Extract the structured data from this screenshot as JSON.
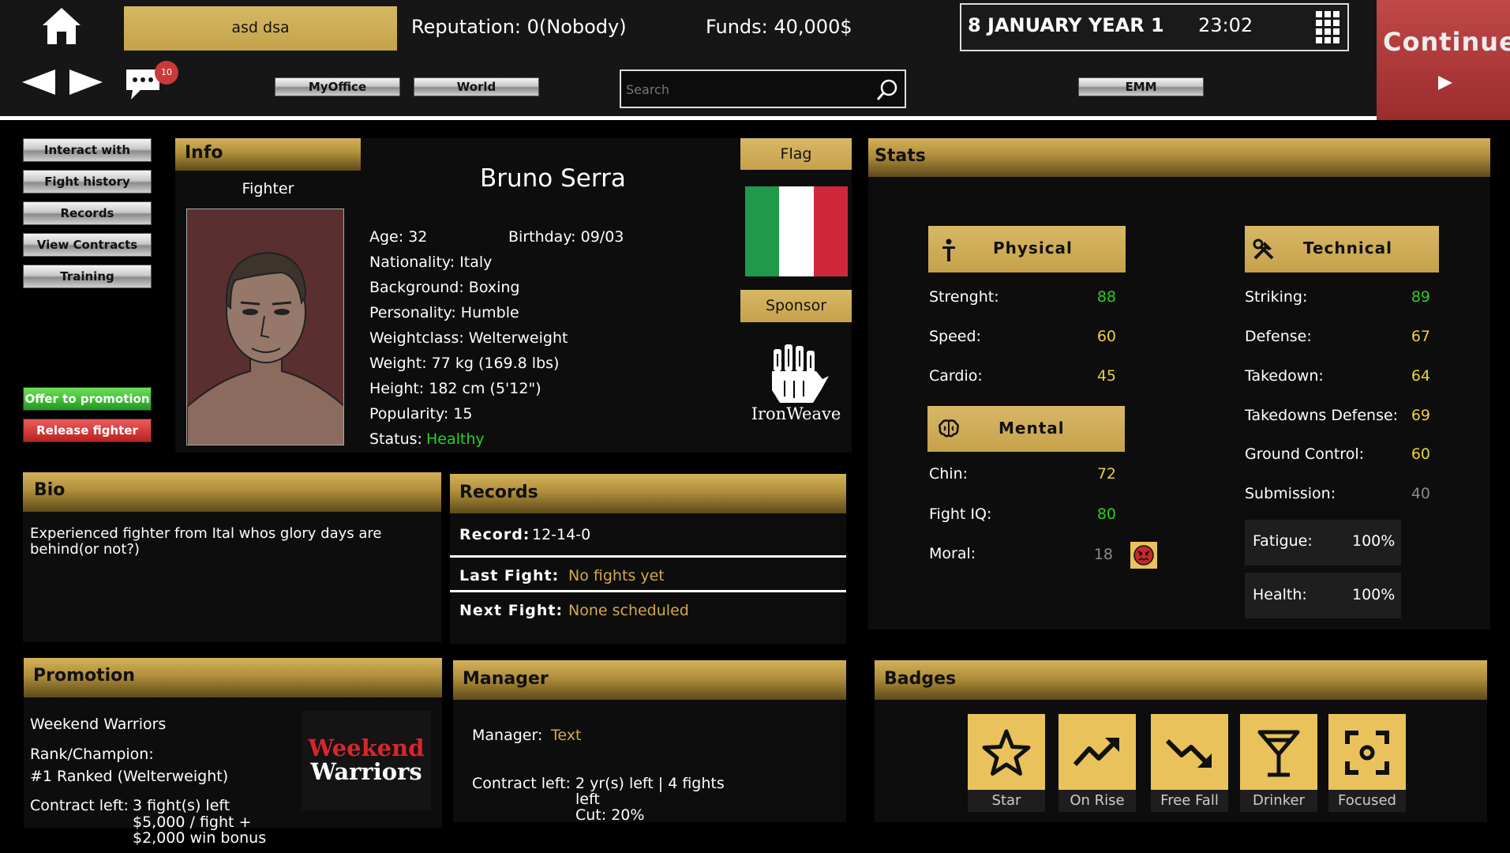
{
  "topbar": {
    "manager_name": "asd dsa",
    "reputation": "Reputation: 0(Nobody)",
    "funds": "Funds: 40,000$",
    "date": "8 JANUARY YEAR 1",
    "time": "23:02",
    "continue_label": "Continue",
    "message_count": "10",
    "nav_myoffice": "MyOffice",
    "nav_world": "World",
    "nav_emm": "EMM",
    "search_placeholder": "Search"
  },
  "sidebar": {
    "buttons": [
      "Interact with",
      "Fight history",
      "Records",
      "View Contracts",
      "Training"
    ],
    "offer_label": "Offer to promotion",
    "release_label": "Release fighter"
  },
  "info": {
    "header": "Info",
    "role": "Fighter",
    "name": "Bruno Serra",
    "age": "Age: 32",
    "birthday": "Birthday: 09/03",
    "nationality": "Nationality: Italy",
    "background": "Background: Boxing",
    "personality": "Personality: Humble",
    "weightclass": "Weightclass: Welterweight",
    "weight": "Weight:  77 kg (169.8 lbs)",
    "height": "Height:  182 cm (5'12\")",
    "popularity": "Popularity:  15",
    "status_label": "Status:",
    "status_value": "Healthy",
    "flag_header": "Flag",
    "sponsor_header": "Sponsor",
    "sponsor_name": "IronWeave"
  },
  "stats": {
    "header": "Stats",
    "physical_header": "Physical",
    "technical_header": "Technical",
    "mental_header": "Mental",
    "physical": [
      {
        "label": "Strenght:",
        "value": "88",
        "color": "#2ecc1f"
      },
      {
        "label": "Speed:",
        "value": "60",
        "color": "#e8d33a"
      },
      {
        "label": "Cardio:",
        "value": "45",
        "color": "#e8d33a"
      }
    ],
    "mental": [
      {
        "label": "Chin:",
        "value": "72",
        "color": "#e8d33a"
      },
      {
        "label": "Fight IQ:",
        "value": "80",
        "color": "#2ecc1f"
      },
      {
        "label": "Moral:",
        "value": "18",
        "color": "#8a8a8a"
      }
    ],
    "technical": [
      {
        "label": "Striking:",
        "value": "89",
        "color": "#2ecc1f"
      },
      {
        "label": "Defense:",
        "value": "67",
        "color": "#e8d33a"
      },
      {
        "label": "Takedown:",
        "value": "64",
        "color": "#e8d33a"
      },
      {
        "label": "Takedowns Defense:",
        "value": "69",
        "color": "#e8d33a"
      },
      {
        "label": "Ground Control:",
        "value": "60",
        "color": "#e8d33a"
      },
      {
        "label": "Submission:",
        "value": "40",
        "color": "#8a8a8a"
      }
    ],
    "fatigue_label": "Fatigue:",
    "fatigue_value": "100%",
    "health_label": "Health:",
    "health_value": "100%"
  },
  "bio": {
    "header": "Bio",
    "text": "Experienced fighter from Ital whos glory days are behind(or not?)"
  },
  "records": {
    "header": "Records",
    "record_label": "Record:",
    "record_value": "12-14-0",
    "last_label": "Last Fight:",
    "last_value": "No fights yet",
    "next_label": "Next Fight:",
    "next_value": "None scheduled"
  },
  "promotion": {
    "header": "Promotion",
    "name": "Weekend Warriors",
    "rank_label": "Rank/Champion:",
    "rank_value": "#1 Ranked (Welterweight)",
    "contract_label": "Contract left:",
    "contract_line1": "3 fight(s) left",
    "contract_line2": "$5,000 / fight  +",
    "contract_line3": "$2,000 win bonus",
    "logo_line1": "Weekend",
    "logo_line2": "Warriors"
  },
  "manager": {
    "header": "Manager",
    "manager_label": "Manager:",
    "manager_value": "Text",
    "contract_label": "Contract left:",
    "contract_line1": "2 yr(s) left  |  4 fights",
    "contract_line2": "left",
    "contract_line3": "Cut: 20%"
  },
  "badges": {
    "header": "Badges",
    "items": [
      {
        "label": "Star",
        "icon": "star-icon"
      },
      {
        "label": "On Rise",
        "icon": "trend-up-icon"
      },
      {
        "label": "Free Fall",
        "icon": "trend-down-icon"
      },
      {
        "label": "Drinker",
        "icon": "cocktail-icon"
      },
      {
        "label": "Focused",
        "icon": "focus-icon"
      }
    ]
  }
}
